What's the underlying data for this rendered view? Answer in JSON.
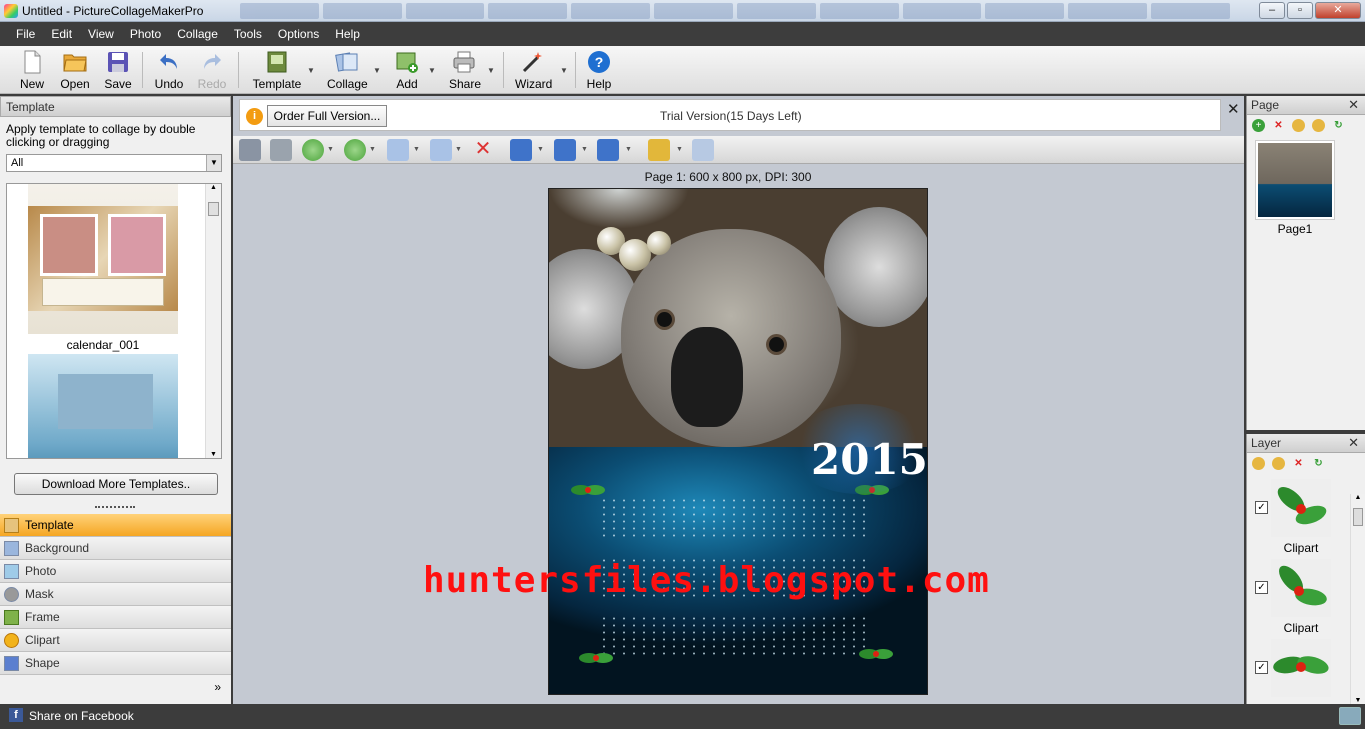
{
  "window": {
    "title": "Untitled - PictureCollageMakerPro",
    "minimize": "–",
    "maximize": "▫",
    "close": "✕"
  },
  "menu": [
    "File",
    "Edit",
    "View",
    "Photo",
    "Collage",
    "Tools",
    "Options",
    "Help"
  ],
  "toolbar": {
    "new": "New",
    "open": "Open",
    "save": "Save",
    "undo": "Undo",
    "redo": "Redo",
    "template": "Template",
    "collage": "Collage",
    "add": "Add",
    "share": "Share",
    "wizard": "Wizard",
    "help": "Help"
  },
  "left_panel": {
    "header": "Template",
    "description": "Apply template to collage by double clicking or dragging",
    "filter": "All",
    "templates": [
      {
        "name": "calendar_001"
      },
      {
        "name": ""
      }
    ],
    "download_button": "Download More Templates..",
    "categories": [
      "Template",
      "Background",
      "Photo",
      "Mask",
      "Frame",
      "Clipart",
      "Shape"
    ],
    "active_category": "Template",
    "more": "»"
  },
  "trial": {
    "order_button": "Order Full Version...",
    "text": "Trial Version(15 Days Left)",
    "close": "✕"
  },
  "page_info": "Page 1: 600 x 800 px, DPI: 300",
  "canvas": {
    "year": "2015"
  },
  "watermark": "huntersfiles.blogspot.com",
  "page_panel": {
    "header": "Page",
    "close": "✕",
    "pages": [
      {
        "label": "Page1"
      }
    ]
  },
  "layer_panel": {
    "header": "Layer",
    "close": "✕",
    "layers": [
      {
        "name": "Clipart",
        "checked": true
      },
      {
        "name": "Clipart",
        "checked": true
      },
      {
        "name": "",
        "checked": true
      }
    ]
  },
  "statusbar": {
    "share": "Share on Facebook"
  },
  "colors": {
    "accent": "#f5a623",
    "menubar": "#3d3d3d",
    "watermark": "#ff1010",
    "calendar_blue": "#0b4d73"
  }
}
